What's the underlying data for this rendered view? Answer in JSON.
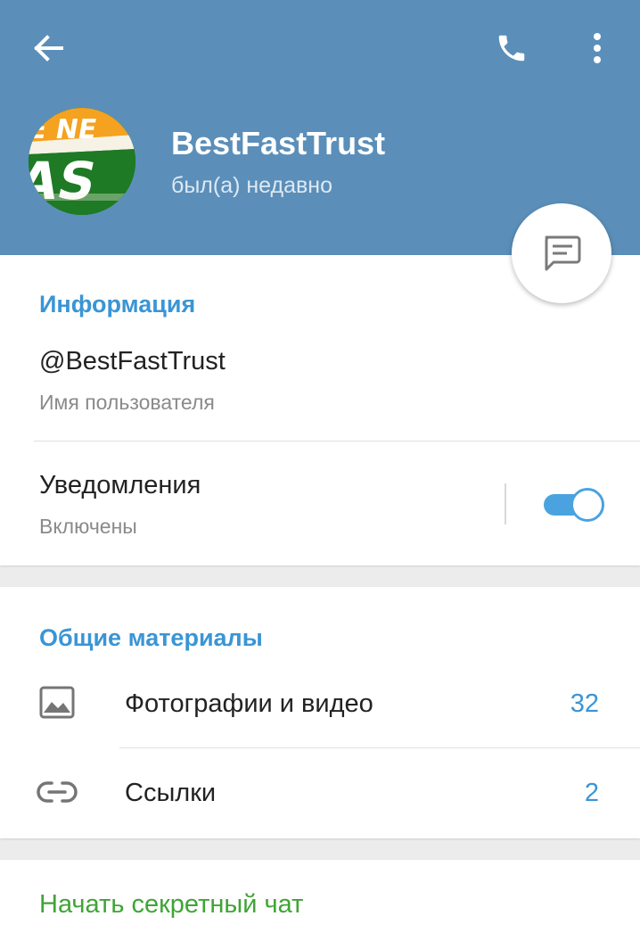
{
  "header": {
    "name": "BestFastTrust",
    "status": "был(а) недавно",
    "back_icon": "arrow-back-icon",
    "call_icon": "phone-icon",
    "more_icon": "more-vertical-icon",
    "fab_icon": "message-icon",
    "color": "#5b8fb9"
  },
  "info": {
    "title": "Информация",
    "username": "@BestFastTrust",
    "username_caption": "Имя пользователя",
    "notifications_label": "Уведомления",
    "notifications_state": "Включены",
    "notifications_on": true
  },
  "shared": {
    "title": "Общие материалы",
    "items": [
      {
        "label": "Фотографии и видео",
        "count": "32",
        "icon": "image-icon"
      },
      {
        "label": "Ссылки",
        "count": "2",
        "icon": "link-icon"
      }
    ]
  },
  "secret_chat": {
    "label": "Начать секретный чат",
    "color": "#3fa535"
  },
  "colors": {
    "accent": "#3a95d5",
    "toggle": "#4aa3df"
  }
}
